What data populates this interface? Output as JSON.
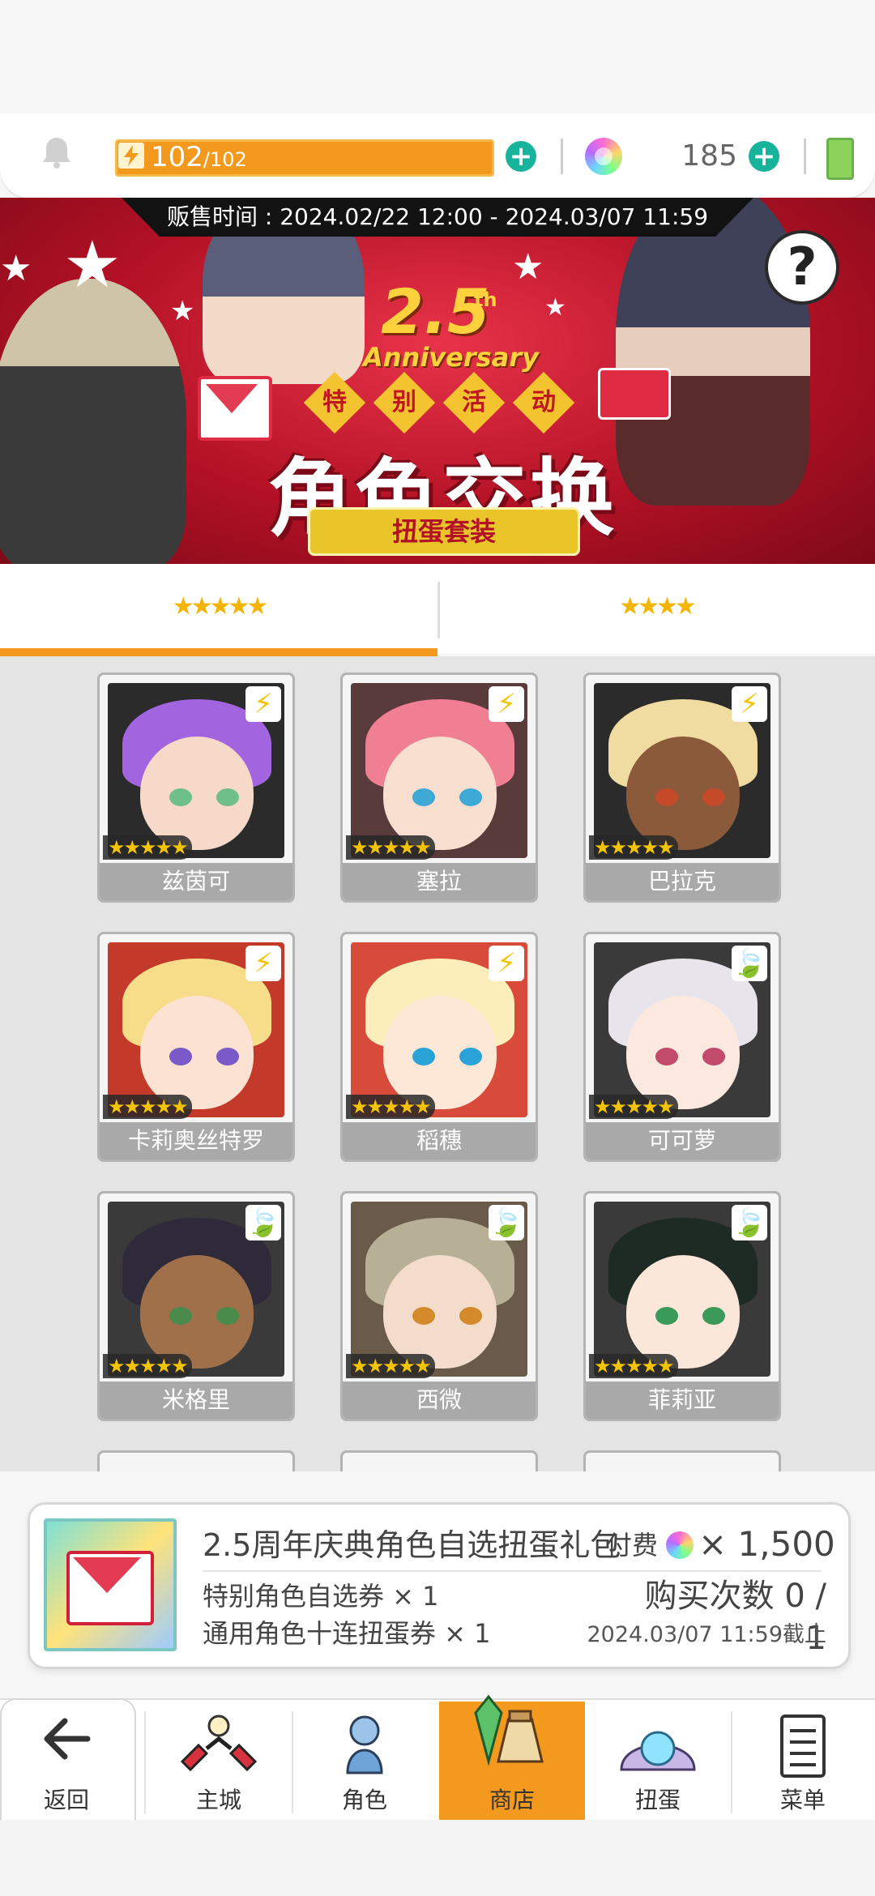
{
  "resources": {
    "stamina_current": "102",
    "stamina_max": "/102",
    "gem_count": "185"
  },
  "banner": {
    "sale_period": "贩售时间 : 2024.02/22 12:00 - 2024.03/07 11:59",
    "anniversary_number": "2.5",
    "anniversary_th": "th",
    "anniversary_word": "Anniversary",
    "event_chars": [
      "特",
      "别",
      "活",
      "动"
    ],
    "title": "角色交换",
    "subtitle": "扭蛋套装",
    "help_symbol": "?"
  },
  "tabs": [
    {
      "label": "★★★★★",
      "active": true
    },
    {
      "label": "★★★★",
      "active": false
    }
  ],
  "characters": [
    {
      "name": "兹茵可",
      "stars": "★★★★★",
      "element": "lightning-icon",
      "element_glyph": "⚡"
    },
    {
      "name": "塞拉",
      "stars": "★★★★★",
      "element": "lightning-icon",
      "element_glyph": "⚡"
    },
    {
      "name": "巴拉克",
      "stars": "★★★★★",
      "element": "lightning-icon",
      "element_glyph": "⚡"
    },
    {
      "name": "卡莉奥丝特罗",
      "stars": "★★★★★",
      "element": "lightning-icon",
      "element_glyph": "⚡"
    },
    {
      "name": "稻穗",
      "stars": "★★★★★",
      "element": "lightning-icon",
      "element_glyph": "⚡"
    },
    {
      "name": "可可萝",
      "stars": "★★★★★",
      "element": "wind-icon",
      "element_glyph": "🍃"
    },
    {
      "name": "米格里",
      "stars": "★★★★★",
      "element": "wind-icon",
      "element_glyph": "🍃"
    },
    {
      "name": "西微",
      "stars": "★★★★★",
      "element": "wind-icon",
      "element_glyph": "🍃"
    },
    {
      "name": "菲莉亚",
      "stars": "★★★★★",
      "element": "wind-icon",
      "element_glyph": "🍃"
    }
  ],
  "package": {
    "title": "2.5周年庆典角色自选扭蛋礼包",
    "paid_label": "付费",
    "price": "× 1,500",
    "item1": "特别角色自选券 × 1",
    "item2": "通用角色十连扭蛋券 × 1",
    "purchase_count": "购买次数 0 / 1",
    "deadline": "2024.03/07 11:59截止"
  },
  "nav": [
    {
      "label": "返回",
      "icon": "back-arrow-icon"
    },
    {
      "label": "主城",
      "icon": "town-icon"
    },
    {
      "label": "角色",
      "icon": "character-icon"
    },
    {
      "label": "商店",
      "icon": "shop-icon",
      "active": true
    },
    {
      "label": "扭蛋",
      "icon": "gacha-icon"
    },
    {
      "label": "菜单",
      "icon": "menu-icon"
    }
  ],
  "colors": {
    "accent": "#f39a1e",
    "plus_button": "#18b39b",
    "banner_red": "#c0161f",
    "card_name_bg": "#a9a9a9"
  }
}
